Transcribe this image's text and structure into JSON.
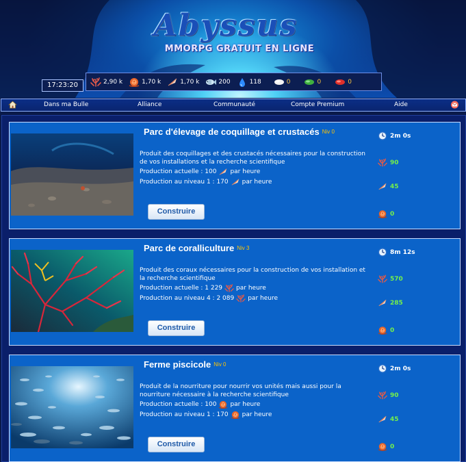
{
  "header": {
    "logo": "Abyssus",
    "subtitle": "MMORPG GRATUIT EN LIGNE",
    "clock": "17:23:20",
    "resources": [
      {
        "icon": "coral-icon",
        "value": "2,90 k"
      },
      {
        "icon": "shell-snail-icon",
        "value": "1,70 k"
      },
      {
        "icon": "conch-icon",
        "value": "1,70 k"
      },
      {
        "icon": "fish-icon",
        "value": "200"
      },
      {
        "icon": "water-drop-icon",
        "value": "118"
      },
      {
        "icon": "white-gem-icon",
        "value": "0"
      },
      {
        "icon": "green-gem-icon",
        "value": "0"
      },
      {
        "icon": "red-gem-icon",
        "value": "0"
      }
    ]
  },
  "nav": {
    "items": [
      "Dans ma Bulle",
      "Alliance",
      "Communauté",
      "Compte Premium",
      "Aide"
    ],
    "home_icon": "home-icon",
    "mail_icon": "mail-icon"
  },
  "buildings": [
    {
      "title": "Parc d'élevage de coquillage et crustacés",
      "level": "Niv 0",
      "description": "Produit des coquillages et des crustacés nécessaires pour la construction de vos installations et la recherche scientifique",
      "current_label": "Production actuelle : 100",
      "next_label": "Production au niveau 1 : 170",
      "per_hour": "par heure",
      "button": "Construire",
      "time": "2m 0s",
      "cost_coral": "90",
      "cost_conch": "45",
      "cost_shell": "0",
      "resource_icon": "conch-icon"
    },
    {
      "title": "Parc de coralliculture",
      "level": "Niv 3",
      "description": "Produit des coraux nécessaires pour la construction de vos installation et la recherche scientifique",
      "current_label": "Production actuelle : 1 229",
      "next_label": "Production au niveau 4 : 2 089",
      "per_hour": "par heure",
      "button": "Construire",
      "time": "8m 12s",
      "cost_coral": "570",
      "cost_conch": "285",
      "cost_shell": "0",
      "resource_icon": "coral-icon"
    },
    {
      "title": "Ferme piscicole",
      "level": "Niv 0",
      "description": "Produit de la nourriture pour nourrir vos unités mais aussi pour la nourriture nécessaire à la recherche scientifique",
      "current_label": "Production actuelle : 100",
      "next_label": "Production au niveau 1 : 170",
      "per_hour": "par heure",
      "button": "Construire",
      "time": "2m 0s",
      "cost_coral": "90",
      "cost_conch": "45",
      "cost_shell": "0",
      "resource_icon": "shell-snail-icon"
    }
  ],
  "colors": {
    "card_bg": "#0b63c9",
    "level": "#ffc400",
    "cost": "#74f04a",
    "gem_count": "#f5c242"
  }
}
